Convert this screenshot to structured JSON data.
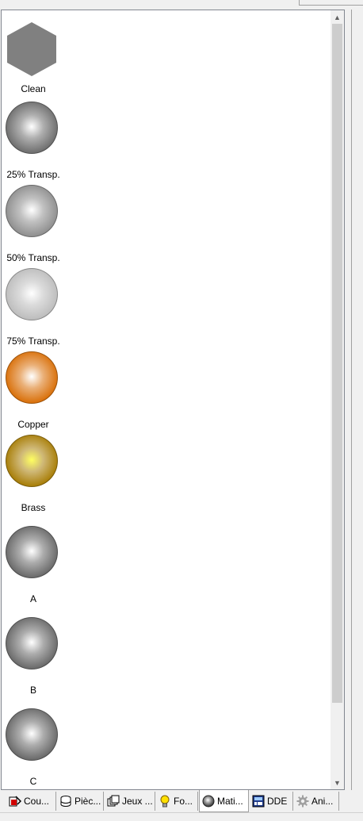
{
  "materials": [
    {
      "label": "Clean",
      "shape": "hexagon",
      "color": "#808080"
    },
    {
      "label": "25% Transp.",
      "shape": "sphere",
      "color": "#6e6e6e"
    },
    {
      "label": "50% Transp.",
      "shape": "sphere",
      "color": "#8f8f8f"
    },
    {
      "label": "75% Transp.",
      "shape": "sphere",
      "color": "#bdbdbd"
    },
    {
      "label": "Copper",
      "shape": "sphere",
      "color": "#d9700a"
    },
    {
      "label": "Brass",
      "shape": "sphere",
      "color": "#a87e08"
    },
    {
      "label": "A",
      "shape": "sphere",
      "color": "#6a6a6a"
    },
    {
      "label": "B",
      "shape": "sphere",
      "color": "#6a6a6a"
    },
    {
      "label": "C",
      "shape": "sphere",
      "color": "#6a6a6a"
    }
  ],
  "tabs": [
    {
      "label": "Cou...",
      "icon": "color-palette-icon",
      "active": false
    },
    {
      "label": "Pièc...",
      "icon": "parts-stack-icon",
      "active": false
    },
    {
      "label": "Jeux ...",
      "icon": "part-sets-icon",
      "active": false
    },
    {
      "label": "Fo...",
      "icon": "lightbulb-icon",
      "active": false
    },
    {
      "label": "Mati...",
      "icon": "material-sphere-icon",
      "active": true
    },
    {
      "label": "DDE",
      "icon": "dde-calculator-icon",
      "active": false
    },
    {
      "label": "Ani...",
      "icon": "gear-icon",
      "active": false
    }
  ],
  "scrollbar": {
    "up_icon": "scroll-up-arrow-icon",
    "down_icon": "scroll-down-arrow-icon"
  }
}
